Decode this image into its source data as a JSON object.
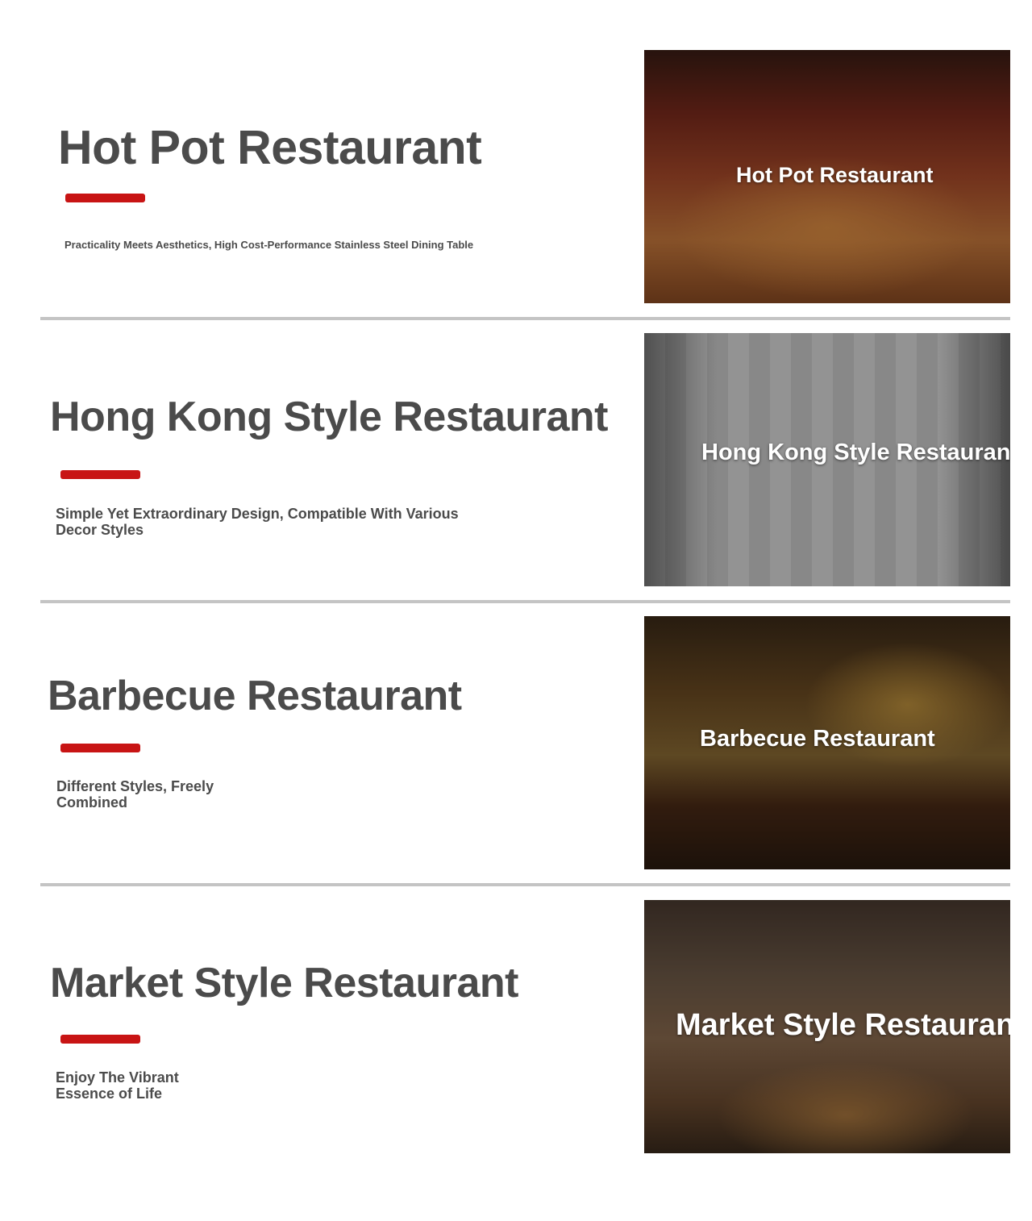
{
  "sections": [
    {
      "heading": "Hot Pot Restaurant",
      "subtitle": "Practicality Meets Aesthetics, High Cost-Performance Stainless Steel Dining Table",
      "image_label": "Hot Pot Restaurant"
    },
    {
      "heading": "Hong Kong Style Restaurant",
      "subtitle": "Simple Yet Extraordinary Design, Compatible With Various Decor Styles",
      "image_label": "Hong Kong Style Restaurant"
    },
    {
      "heading": "Barbecue Restaurant",
      "subtitle": "Different Styles, Freely Combined",
      "image_label": "Barbecue Restaurant"
    },
    {
      "heading": "Market Style Restaurant",
      "subtitle": "Enjoy The Vibrant Essence of Life",
      "image_label": "Market Style Restaurant"
    }
  ],
  "colors": {
    "heading": "#4b4b4b",
    "accent_bar": "#c81414",
    "divider": "#c4c4c4",
    "background": "#ffffff"
  }
}
